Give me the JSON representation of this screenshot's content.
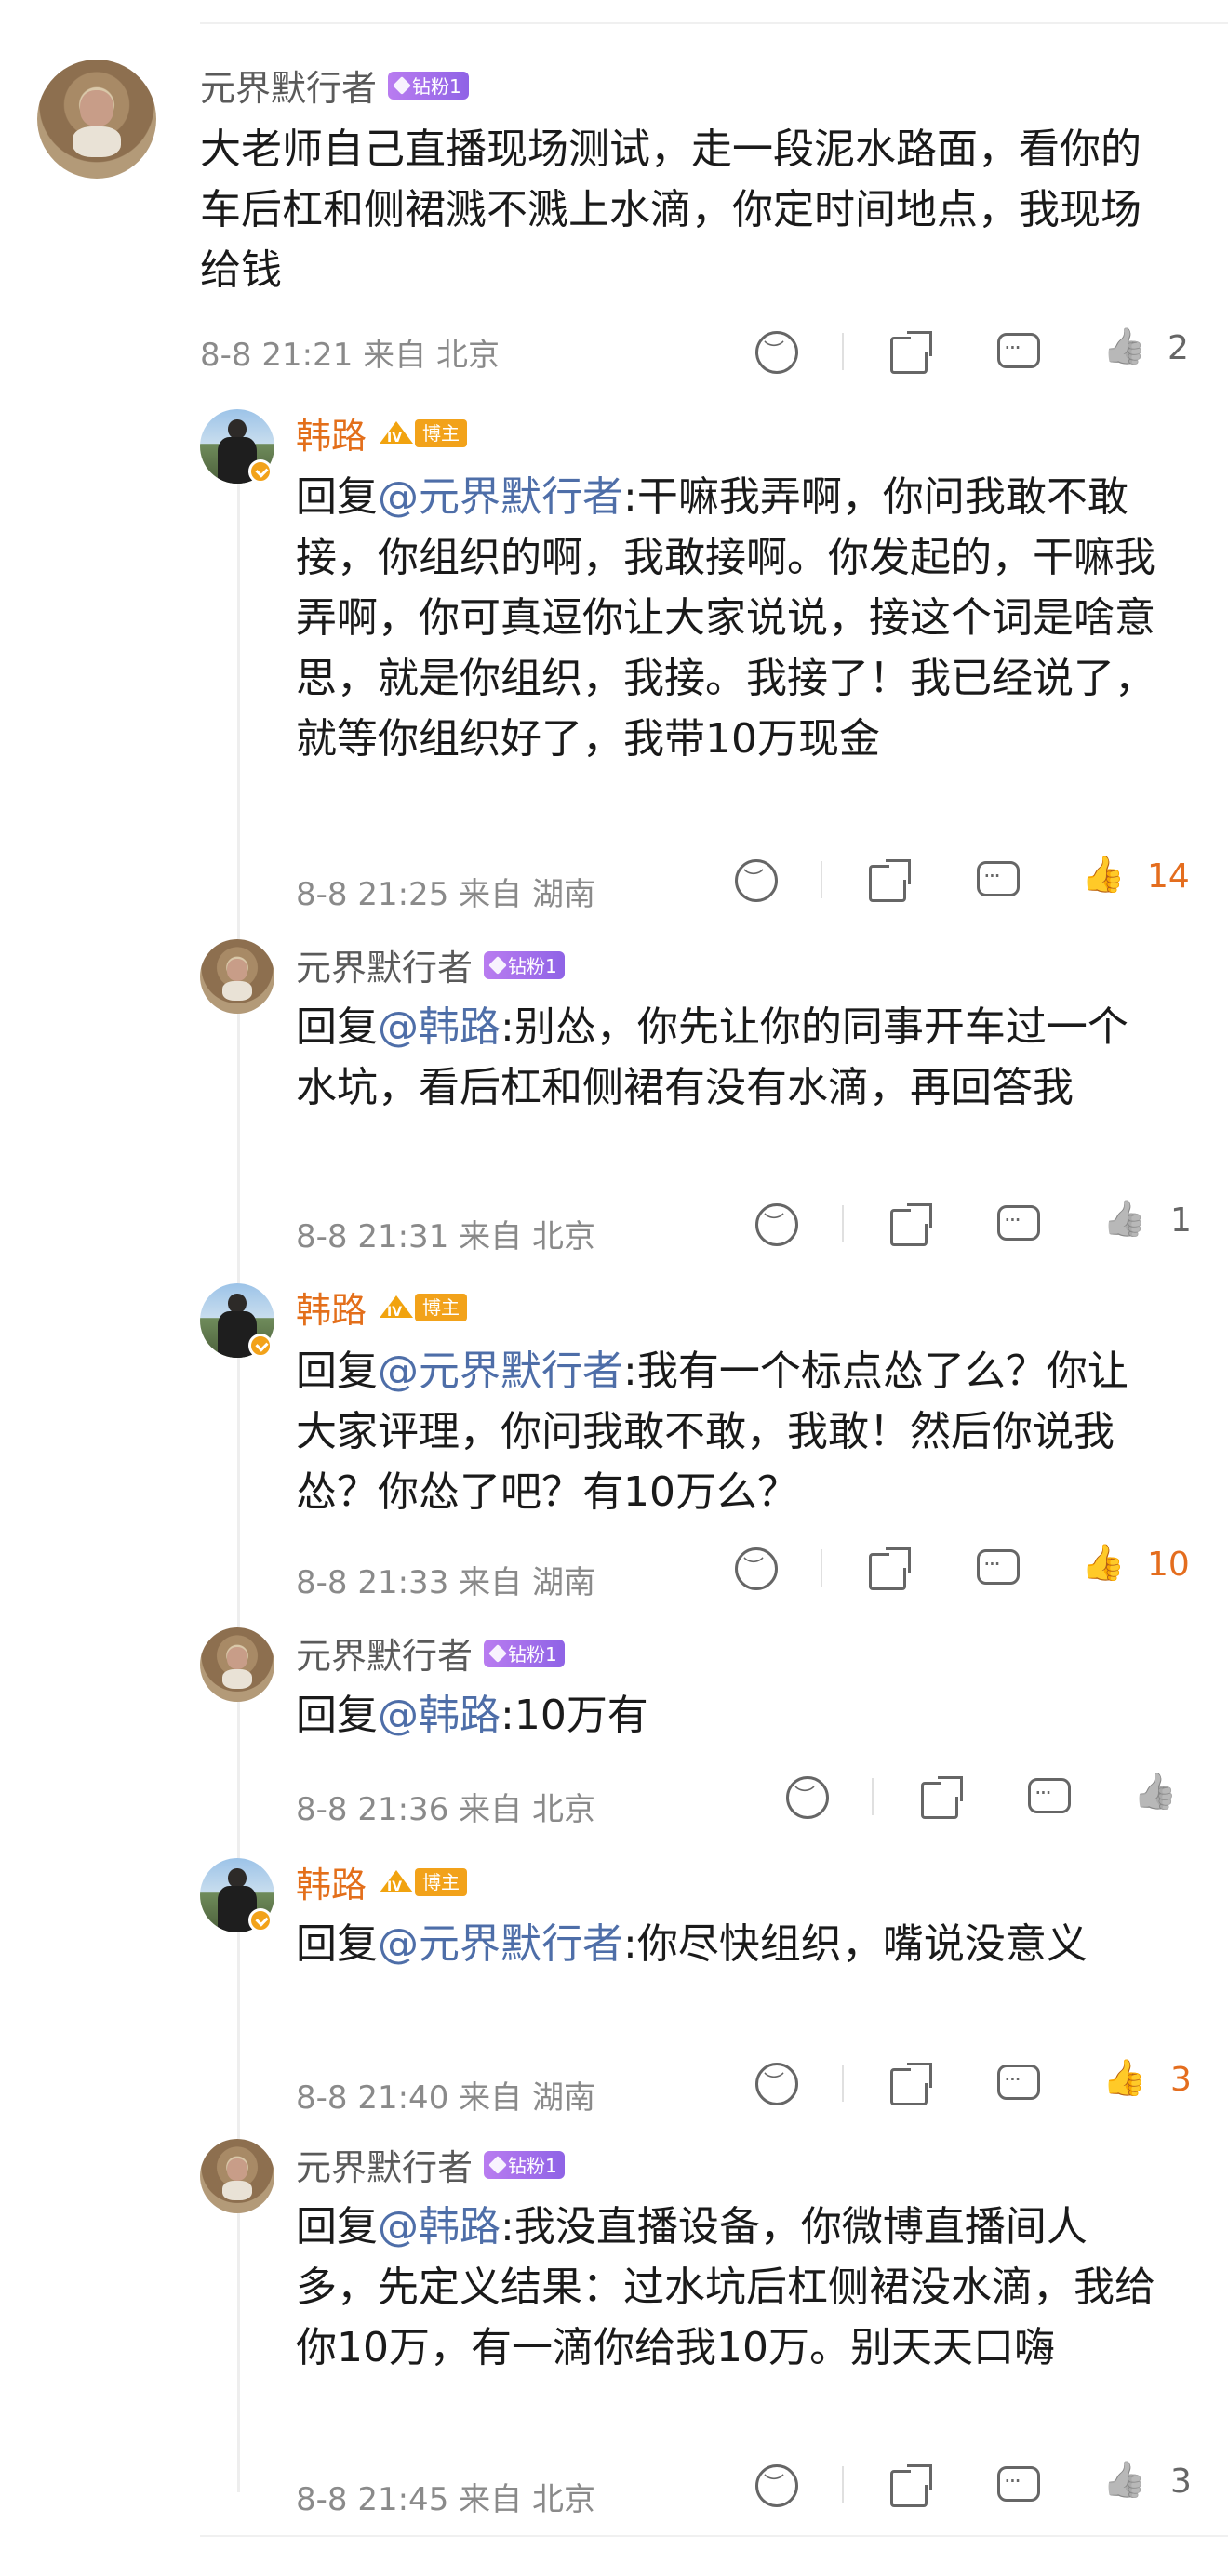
{
  "comments": [
    {
      "user": "元界默行者",
      "fan_badge": "钻粉1",
      "text": "大老师自己直播现场测试，走一段泥水路面，看你的车后杠和侧裙溅不溅上水滴，你定时间地点，我现场给钱",
      "time": "8-8 21:21",
      "from": "来自 北京",
      "likes": "2",
      "liked": false
    },
    {
      "user": "韩路",
      "blogger_tag": "博主",
      "reply_prefix": "回复",
      "mention": "@元界默行者",
      "text": ":干嘛我弄啊，你问我敢不敢接，你组织的啊，我敢接啊。你发起的，干嘛我弄啊，你可真逗你让大家说说，接这个词是啥意思，就是你组织，我接。我接了！我已经说了，就等你组织好了，我带10万现金",
      "time": "8-8 21:25",
      "from": "来自 湖南",
      "likes": "14",
      "liked": true
    },
    {
      "user": "元界默行者",
      "fan_badge": "钻粉1",
      "reply_prefix": "回复",
      "mention": "@韩路",
      "text": ":别怂，你先让你的同事开车过一个水坑，看后杠和侧裙有没有水滴，再回答我",
      "time": "8-8 21:31",
      "from": "来自 北京",
      "likes": "1",
      "liked": false
    },
    {
      "user": "韩路",
      "blogger_tag": "博主",
      "reply_prefix": "回复",
      "mention": "@元界默行者",
      "text": ":我有一个标点怂了么？你让大家评理，你问我敢不敢，我敢！然后你说我怂？你怂了吧？有10万么？",
      "time": "8-8 21:33",
      "from": "来自 湖南",
      "likes": "10",
      "liked": true
    },
    {
      "user": "元界默行者",
      "fan_badge": "钻粉1",
      "reply_prefix": "回复",
      "mention": "@韩路",
      "text": ":10万有",
      "time": "8-8 21:36",
      "from": "来自 北京",
      "likes": "",
      "liked": false
    },
    {
      "user": "韩路",
      "blogger_tag": "博主",
      "reply_prefix": "回复",
      "mention": "@元界默行者",
      "text": ":你尽快组织，嘴说没意义",
      "time": "8-8 21:40",
      "from": "来自 湖南",
      "likes": "3",
      "liked": true
    },
    {
      "user": "元界默行者",
      "fan_badge": "钻粉1",
      "reply_prefix": "回复",
      "mention": "@韩路",
      "text": ":我没直播设备，你微博直播间人多，先定义结果：过水坑后杠侧裙没水滴，我给你10万，有一滴你给我10万。别天天口嗨",
      "time": "8-8 21:45",
      "from": "来自 北京",
      "likes": "3",
      "liked": false
    }
  ],
  "colors": {
    "name_orange": "#e36f1b",
    "mention_blue": "#4e6ea8",
    "like_active": "#e46d1e"
  },
  "icons": [
    "sad-face-icon",
    "share-icon",
    "comment-icon",
    "like-icon",
    "verified-icon",
    "crown-icon",
    "diamond-icon"
  ]
}
